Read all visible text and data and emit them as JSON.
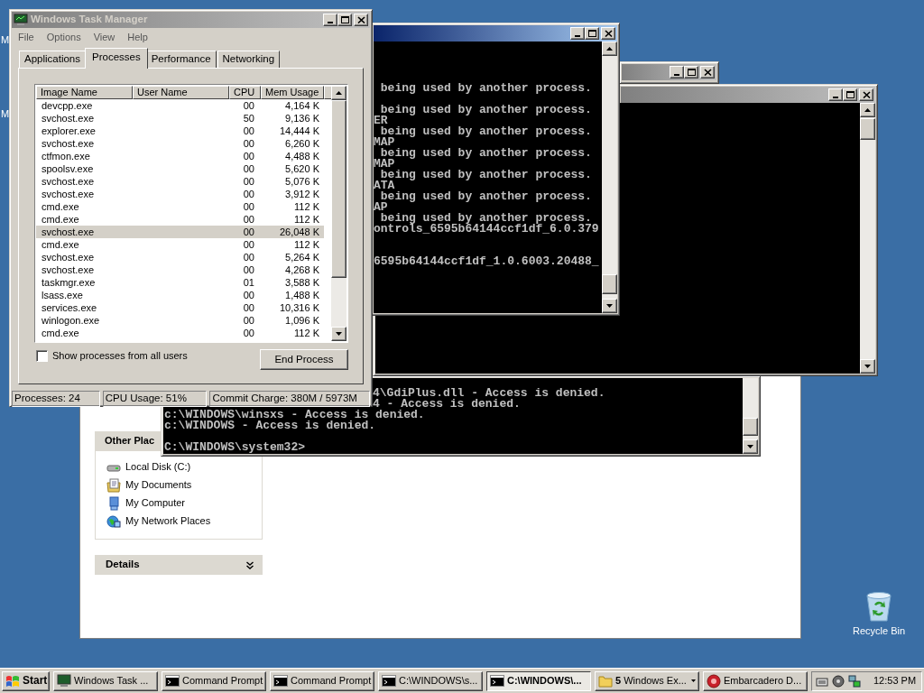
{
  "desktop": {
    "cut_icon_labels": [
      "M",
      "M"
    ],
    "recycle_bin": {
      "label": "Recycle Bin"
    }
  },
  "explorer": {
    "other_places": {
      "title": "Other Plac",
      "items": [
        {
          "label": "Local Disk (C:)",
          "kind": "disk"
        },
        {
          "label": "My Documents",
          "kind": "documents"
        },
        {
          "label": "My Computer",
          "kind": "computer"
        },
        {
          "label": "My Network Places",
          "kind": "network"
        }
      ]
    },
    "details": {
      "title": "Details"
    }
  },
  "consoles": [
    {
      "title_bar": {
        "active": true
      },
      "lines": [
        {
          "kind": "full",
          "text": " being used by another process."
        },
        {
          "kind": "blank"
        },
        {
          "kind": "full",
          "text": " being used by another process."
        },
        {
          "kind": "full",
          "text": "ER"
        },
        {
          "kind": "full",
          "text": " being used by another process."
        },
        {
          "kind": "full",
          "text": "MAP"
        },
        {
          "kind": "full",
          "text": " being used by another process."
        },
        {
          "kind": "full",
          "text": "MAP"
        },
        {
          "kind": "full",
          "text": " being used by another process."
        },
        {
          "kind": "full",
          "text": "ATA"
        },
        {
          "kind": "full",
          "text": " being used by another process."
        },
        {
          "kind": "full",
          "text": "AP"
        },
        {
          "kind": "full",
          "text": " being used by another process."
        },
        {
          "kind": "full",
          "text": "ontrols_6595b64144ccf1df_6.0.379"
        },
        {
          "kind": "blank"
        },
        {
          "kind": "blank"
        },
        {
          "kind": "full",
          "text": "6595b64144ccf1df_1.0.6003.20488_"
        }
      ]
    },
    {
      "title_bar": {
        "active": false
      }
    },
    {
      "title_bar": {
        "active": false
      }
    },
    {
      "lines": [
        {
          "kind": "tail",
          "text": "4\\GdiPlus.dll - Access is denied."
        },
        {
          "kind": "tail",
          "text": "4 - Access is denied."
        },
        {
          "kind": "full",
          "text": "c:\\WINDOWS\\winsxs - Access is denied."
        },
        {
          "kind": "full",
          "text": "c:\\WINDOWS - Access is denied."
        },
        {
          "kind": "blank"
        },
        {
          "kind": "full",
          "text": "C:\\WINDOWS\\system32>"
        }
      ]
    }
  ],
  "task_manager": {
    "title": "Windows Task Manager",
    "active": false,
    "menu": [
      "File",
      "Options",
      "View",
      "Help"
    ],
    "tabs": [
      {
        "label": "Applications",
        "selected": false
      },
      {
        "label": "Processes",
        "selected": true
      },
      {
        "label": "Performance",
        "selected": false
      },
      {
        "label": "Networking",
        "selected": false
      }
    ],
    "columns": [
      "Image Name",
      "User Name",
      "CPU",
      "Mem Usage"
    ],
    "rows": [
      {
        "image": "devcpp.exe",
        "cpu": "00",
        "mem": "4,164 K",
        "selected": false
      },
      {
        "image": "svchost.exe",
        "cpu": "50",
        "mem": "9,136 K",
        "selected": false
      },
      {
        "image": "explorer.exe",
        "cpu": "00",
        "mem": "14,444 K",
        "selected": false
      },
      {
        "image": "svchost.exe",
        "cpu": "00",
        "mem": "6,260 K",
        "selected": false
      },
      {
        "image": "ctfmon.exe",
        "cpu": "00",
        "mem": "4,488 K",
        "selected": false
      },
      {
        "image": "spoolsv.exe",
        "cpu": "00",
        "mem": "5,620 K",
        "selected": false
      },
      {
        "image": "svchost.exe",
        "cpu": "00",
        "mem": "5,076 K",
        "selected": false
      },
      {
        "image": "svchost.exe",
        "cpu": "00",
        "mem": "3,912 K",
        "selected": false
      },
      {
        "image": "cmd.exe",
        "cpu": "00",
        "mem": "112 K",
        "selected": false
      },
      {
        "image": "cmd.exe",
        "cpu": "00",
        "mem": "112 K",
        "selected": false
      },
      {
        "image": "svchost.exe",
        "cpu": "00",
        "mem": "26,048 K",
        "selected": true
      },
      {
        "image": "cmd.exe",
        "cpu": "00",
        "mem": "112 K",
        "selected": false
      },
      {
        "image": "svchost.exe",
        "cpu": "00",
        "mem": "5,264 K",
        "selected": false
      },
      {
        "image": "svchost.exe",
        "cpu": "00",
        "mem": "4,268 K",
        "selected": false
      },
      {
        "image": "taskmgr.exe",
        "cpu": "01",
        "mem": "3,588 K",
        "selected": false
      },
      {
        "image": "lsass.exe",
        "cpu": "00",
        "mem": "1,488 K",
        "selected": false
      },
      {
        "image": "services.exe",
        "cpu": "00",
        "mem": "10,316 K",
        "selected": false
      },
      {
        "image": "winlogon.exe",
        "cpu": "00",
        "mem": "1,096 K",
        "selected": false
      },
      {
        "image": "cmd.exe",
        "cpu": "00",
        "mem": "112 K",
        "selected": false
      }
    ],
    "show_all_users": {
      "label": "Show processes from all users",
      "checked": false
    },
    "end_process": "End Process",
    "status_bar": [
      "Processes: 24",
      "CPU Usage: 51%",
      "Commit Charge: 380M / 5973M"
    ]
  },
  "taskbar": {
    "start": "Start",
    "buttons": [
      {
        "label": "Windows Task ...",
        "kind": "taskmgr",
        "selected": false
      },
      {
        "label": "Command Prompt",
        "kind": "console",
        "selected": false
      },
      {
        "label": "Command Prompt",
        "kind": "console",
        "selected": false
      },
      {
        "label": "C:\\WINDOWS\\s...",
        "kind": "console",
        "selected": false
      },
      {
        "label": "C:\\WINDOWS\\...",
        "kind": "console",
        "selected": true
      },
      {
        "label": "**5** Windows Ex...",
        "kind": "folder",
        "selected": false
      },
      {
        "label": "Embarcadero D...",
        "kind": "devapp",
        "selected": false
      }
    ],
    "clock": "12:53 PM"
  }
}
